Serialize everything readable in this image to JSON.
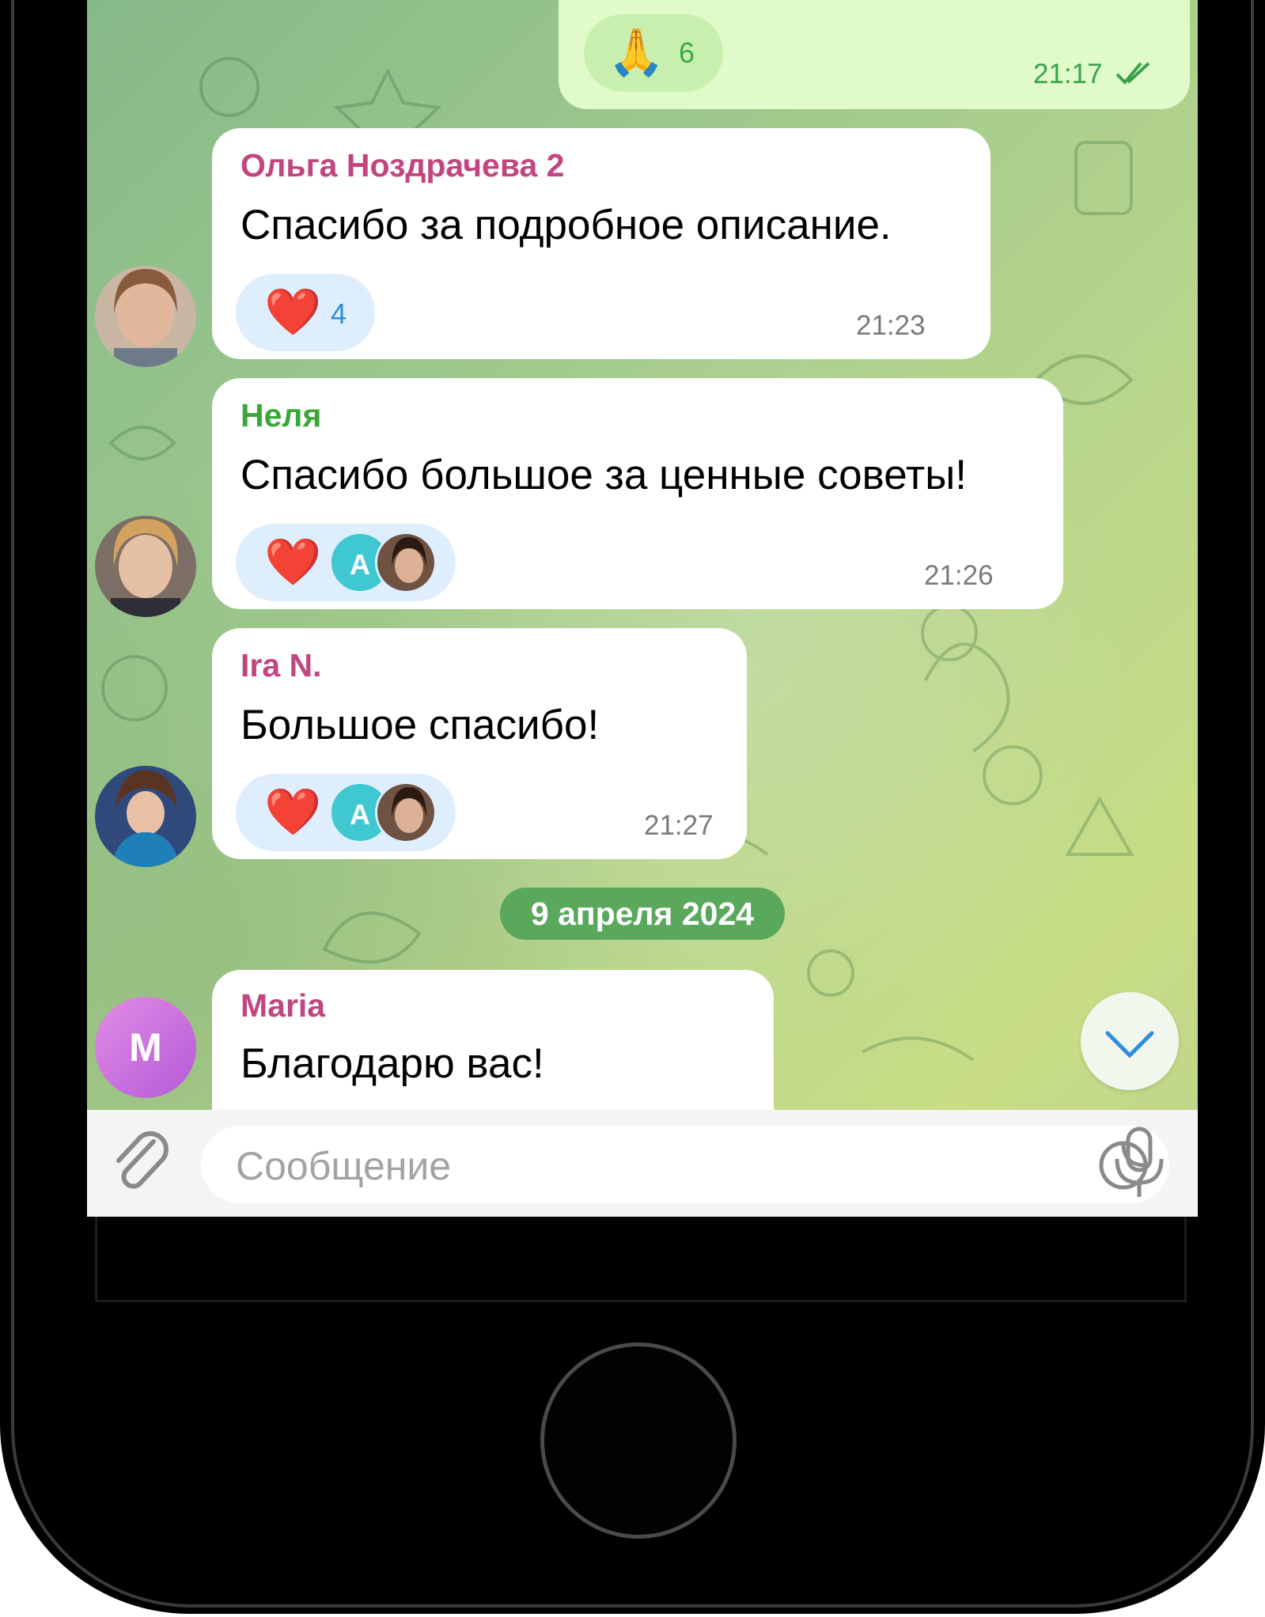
{
  "outgoing": {
    "reaction_emoji": "🙏",
    "reaction_count": "6",
    "time": "21:17"
  },
  "messages": [
    {
      "sender": "Ольга Ноздрачева 2",
      "sender_color": "#c2457f",
      "text": "Спасибо за подробное описание.",
      "reaction_emoji": "❤️",
      "reaction_count": "4",
      "time": "21:23"
    },
    {
      "sender": "Неля",
      "sender_color": "#3aa836",
      "text": "Спасибо большое за ценные советы!",
      "reaction_emoji": "❤️",
      "reactor_initial": "A",
      "time": "21:26"
    },
    {
      "sender": "Ira N.",
      "sender_color": "#c2457f",
      "text": "Большое спасибо!",
      "reaction_emoji": "❤️",
      "reactor_initial": "A",
      "time": "21:27"
    },
    {
      "sender": "Maria",
      "sender_color": "#c2457f",
      "text": "Благодарю вас!",
      "avatar_initial": "M"
    }
  ],
  "date_separator": "9 апреля 2024",
  "input": {
    "placeholder": "Сообщение"
  },
  "icons": {
    "attach": "paperclip-icon",
    "sticker": "sticker-icon",
    "mic": "microphone-icon",
    "scroll_down": "chevron-down-icon",
    "read_receipt": "double-check-icon"
  }
}
